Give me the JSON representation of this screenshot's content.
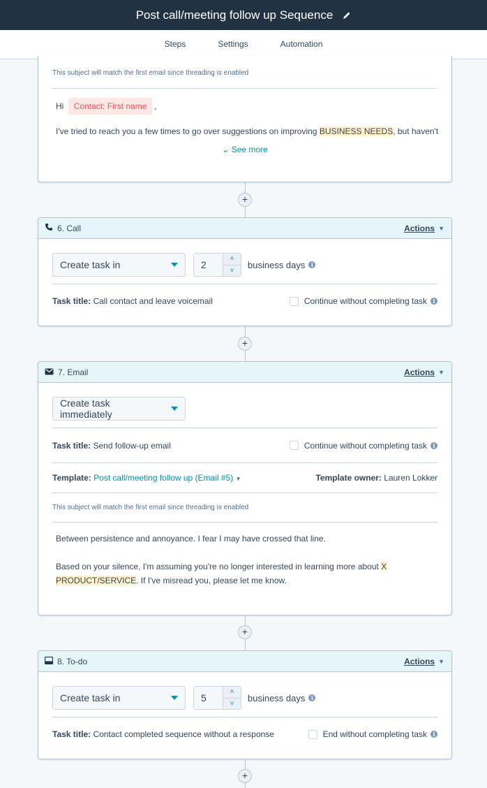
{
  "header": {
    "title": "Post call/meeting follow up Sequence",
    "edit_icon": "pencil-icon"
  },
  "tabs": [
    {
      "label": "Steps",
      "active": true
    },
    {
      "label": "Settings",
      "active": false
    },
    {
      "label": "Automation",
      "active": false
    }
  ],
  "step5_partial": {
    "threading_note": "This subject will match the first email since threading is enabled",
    "greeting": "Hi",
    "token": "Contact: First name",
    "greeting_suffix": ",",
    "body_before": "I've tried to reach you a few times to go over suggestions on improving ",
    "body_highlight": "BUSINESS NEEDS",
    "body_after": ", but haven't",
    "see_more": "See more"
  },
  "add_step_label": "+",
  "steps": [
    {
      "number_title": "6. Call",
      "icon": "phone-icon",
      "actions_label": "Actions",
      "delay_select": "Create task in",
      "delay_value": "2",
      "delay_unit": "business days",
      "task_title_label": "Task title:",
      "task_title": "Call contact and leave voicemail",
      "checkbox_label": "Continue without completing task",
      "checkbox_checked": false
    },
    {
      "number_title": "7. Email",
      "icon": "envelope-icon",
      "actions_label": "Actions",
      "delay_select": "Create task immediately",
      "task_title_label": "Task title:",
      "task_title": "Send follow-up email",
      "checkbox_label": "Continue without completing task",
      "checkbox_checked": false,
      "template_label": "Template:",
      "template_name": "Post call/meeting follow up (Email #5)",
      "template_owner_label": "Template owner:",
      "template_owner": "Lauren Lokker",
      "threading_note": "This subject will match the first email since threading is enabled",
      "body_line1": "Between persistence and annoyance. I fear I may have crossed that line.",
      "body_line2_before": "Based on your silence, I'm assuming you're no longer interested in learning more about ",
      "body_line2_highlight_a": "X",
      "body_line2_highlight_b": "PRODUCT/SERVICE",
      "body_line2_after": ". If I've misread you, please let me know."
    },
    {
      "number_title": "8. To-do",
      "icon": "todo-icon",
      "actions_label": "Actions",
      "delay_select": "Create task in",
      "delay_value": "5",
      "delay_unit": "business days",
      "task_title_label": "Task title:",
      "task_title": "Contact completed sequence without a response",
      "checkbox_label": "End without completing task",
      "checkbox_checked": false
    }
  ],
  "colors": {
    "topbar": "#213343",
    "accent": "#0091ae",
    "header_bg": "#e5f5f8",
    "token_text": "#f2545b",
    "highlight": "#fef0c7"
  }
}
